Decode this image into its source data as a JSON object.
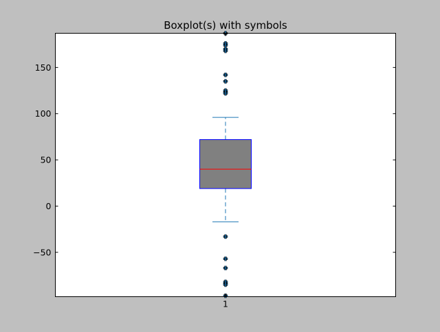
{
  "chart_data": {
    "type": "box",
    "title": "Boxplot(s) with symbols",
    "xlabel": "",
    "ylabel": "",
    "categories": [
      "1"
    ],
    "ylim": [
      -98,
      187
    ],
    "yticks": [
      -50,
      0,
      50,
      100,
      150
    ],
    "ytick_labels": [
      "−50",
      "0",
      "50",
      "100",
      "150"
    ],
    "grid": false,
    "boxes": [
      {
        "label": "1",
        "whisker_low": -17,
        "q1": 19,
        "median": 40,
        "q3": 72,
        "whisker_high": 96,
        "fliers": [
          187,
          176,
          174,
          170,
          168,
          142,
          135,
          125,
          123,
          122,
          -33,
          -57,
          -67,
          -82,
          -84,
          -85,
          -97
        ]
      }
    ],
    "colors": {
      "figure_bg": "#bfbfbf",
      "axes_bg": "#ffffff",
      "box_fill": "#808080",
      "box_edge": "#0000ff",
      "median": "#ff0000",
      "whisker": "#1f77b4",
      "flier": "#1f77b4",
      "flier_edge": "#000000"
    }
  }
}
